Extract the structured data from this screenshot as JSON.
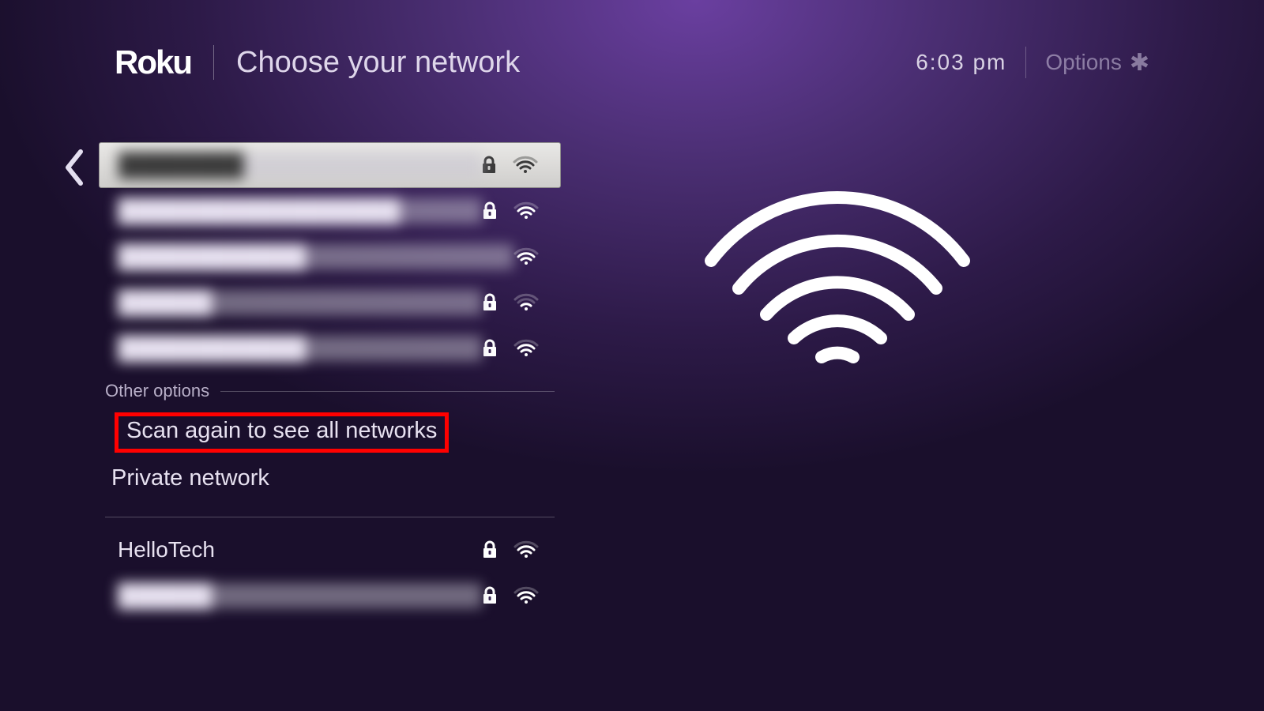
{
  "header": {
    "logo": "Roku",
    "title": "Choose your network",
    "clock": "6:03  pm",
    "options_label": "Options"
  },
  "networks": [
    {
      "label": "████████",
      "blurred": true,
      "locked": true,
      "strength": 3,
      "selected": true
    },
    {
      "label": "██████████████████",
      "blurred": true,
      "locked": true,
      "strength": 3,
      "selected": false
    },
    {
      "label": "████████████",
      "blurred": true,
      "locked": false,
      "strength": 3,
      "selected": false
    },
    {
      "label": "██████",
      "blurred": true,
      "locked": true,
      "strength": 2,
      "selected": false
    },
    {
      "label": "████████████",
      "blurred": true,
      "locked": true,
      "strength": 3,
      "selected": false
    }
  ],
  "other_options_header": "Other options",
  "other_options": [
    {
      "label": "Scan again to see all networks",
      "highlighted": true
    },
    {
      "label": "Private network",
      "highlighted": false
    }
  ],
  "more_networks": [
    {
      "label": "HelloTech",
      "blurred": false,
      "locked": true,
      "strength": 3
    },
    {
      "label": "██████",
      "blurred": true,
      "locked": true,
      "strength": 3
    }
  ],
  "icons": {
    "asterisk": "✱"
  }
}
